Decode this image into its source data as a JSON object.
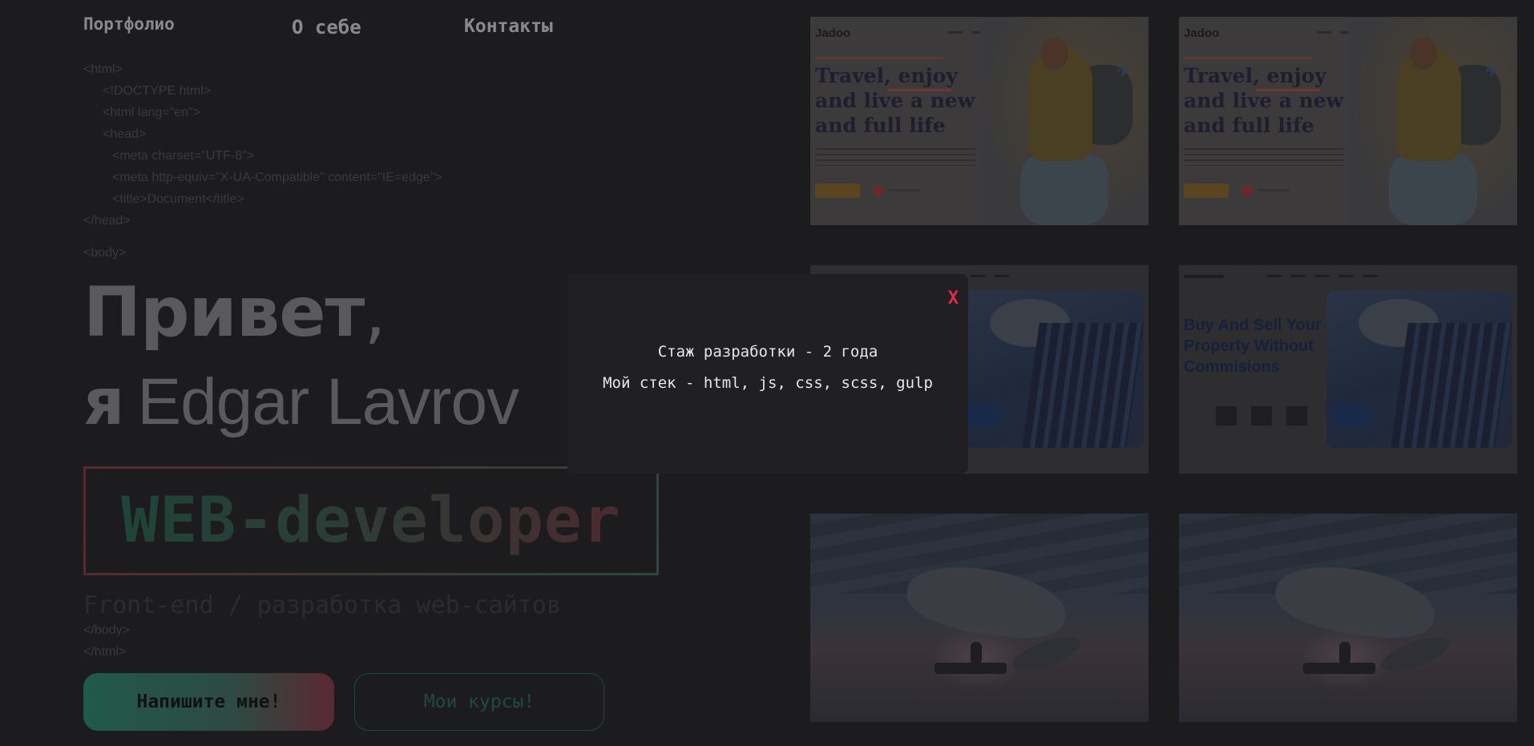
{
  "nav": {
    "portfolio": "Портфолио",
    "about": "О себе",
    "contacts": "Контакты"
  },
  "code_lines": [
    "<html>",
    "<!DOCTYPE html>",
    "<html lang=\"en\">",
    "<head>",
    "<meta charset=\"UTF-8\">",
    "<meta http-equiv=\"X-UA-Compatible\" content=\"IE=edge\">",
    "<title>Document</title>",
    "</head>",
    "<body>",
    "</body>",
    "</html>"
  ],
  "hero": {
    "greeting": "Привет",
    "comma": ",",
    "ya": "я",
    "name": "Edgar Lavrov",
    "role": "WEB-developer",
    "subtitle": "Front-end / разработка web-сайтов",
    "write_button": "Напишите мне!",
    "courses_button": "Мои курсы!"
  },
  "thumbs": {
    "jadoo_logo": "Jadoo",
    "jadoo_headline": "Travel, enjoy and live a new and full life",
    "house_headline": "Buy And Sell Your Property Without Commisions"
  },
  "modal": {
    "close": "X",
    "experience": "Стаж разработки - 2 года",
    "stack": "Мой стек - html, js, css, scss, gulp"
  },
  "colors": {
    "background": "#1c1b1d",
    "close_accent": "#e8284a",
    "modal_bg": "#202022"
  }
}
